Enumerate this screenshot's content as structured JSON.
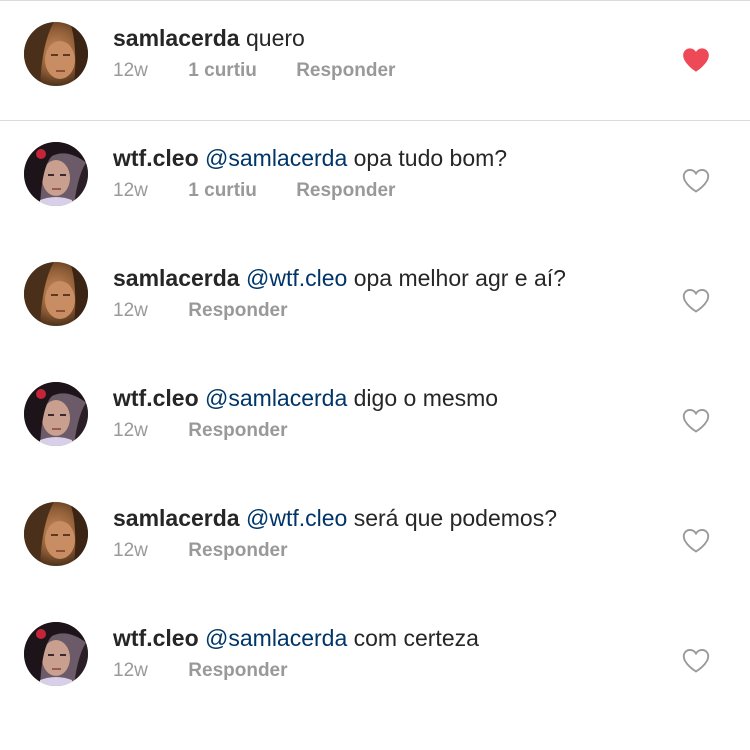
{
  "colors": {
    "text": "#262626",
    "mention": "#003569",
    "meta": "#999999",
    "liked_heart": "#ed4956",
    "divider": "#dbdbdb"
  },
  "comments": [
    {
      "username": "samlacerda",
      "mention": "",
      "text": "quero",
      "time": "12w",
      "likes": "1 curtiu",
      "reply": "Responder",
      "liked": true
    },
    {
      "username": "wtf.cleo",
      "mention": "@samlacerda",
      "text": "opa tudo bom?",
      "time": "12w",
      "likes": "1 curtiu",
      "reply": "Responder",
      "liked": false
    },
    {
      "username": "samlacerda",
      "mention": "@wtf.cleo",
      "text": "opa melhor agr e aí?",
      "time": "12w",
      "likes": "",
      "reply": "Responder",
      "liked": false
    },
    {
      "username": "wtf.cleo",
      "mention": "@samlacerda",
      "text": "digo o mesmo",
      "time": "12w",
      "likes": "",
      "reply": "Responder",
      "liked": false
    },
    {
      "username": "samlacerda",
      "mention": "@wtf.cleo",
      "text": "será que podemos?",
      "time": "12w",
      "likes": "",
      "reply": "Responder",
      "liked": false
    },
    {
      "username": "wtf.cleo",
      "mention": "@samlacerda",
      "text": "com certeza",
      "time": "12w",
      "likes": "",
      "reply": "Responder",
      "liked": false
    }
  ]
}
